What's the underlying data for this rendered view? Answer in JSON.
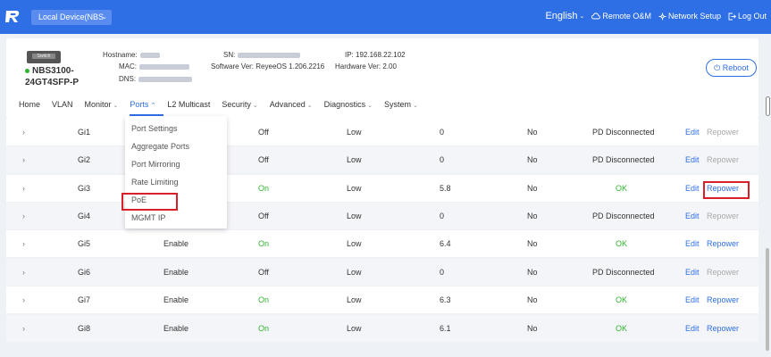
{
  "header": {
    "device_select": "Local Device(NBS",
    "language": "English",
    "remote": "Remote O&M",
    "network_setup": "Network Setup",
    "logout": "Log Out"
  },
  "device": {
    "model_line1": "NBS3100-",
    "model_line2": "24GT4SFP-P",
    "switch_label": "Switch",
    "hostname_label": "Hostname:",
    "mac_label": "MAC:",
    "dns_label": "DNS:",
    "sn_label": "SN:",
    "software_label": "Software Ver:",
    "software_value": "ReyeeOS 1.206.2216",
    "ip_label": "IP:",
    "ip_value": "192.168.22.102",
    "hardware_label": "Hardware Ver:",
    "hardware_value": "2.00",
    "reboot": "Reboot"
  },
  "menu": {
    "home": "Home",
    "vlan": "VLAN",
    "monitor": "Monitor",
    "ports": "Ports",
    "l2multicast": "L2 Multicast",
    "security": "Security",
    "advanced": "Advanced",
    "diagnostics": "Diagnostics",
    "system": "System"
  },
  "ports_dropdown": {
    "port_settings": "Port Settings",
    "aggregate_ports": "Aggregate Ports",
    "port_mirroring": "Port Mirroring",
    "rate_limiting": "Rate Limiting",
    "poe": "PoE",
    "mgmt_ip": "MGMT IP"
  },
  "rows": [
    {
      "port": "Gi1",
      "enable": "",
      "status": "Off",
      "priority": "Low",
      "power": "0",
      "nonstd": "No",
      "pd": "PD Disconnected",
      "edit": "Edit",
      "repower": "Repower"
    },
    {
      "port": "Gi2",
      "enable": "",
      "status": "Off",
      "priority": "Low",
      "power": "0",
      "nonstd": "No",
      "pd": "PD Disconnected",
      "edit": "Edit",
      "repower": "Repower"
    },
    {
      "port": "Gi3",
      "enable": "",
      "status": "On",
      "priority": "Low",
      "power": "5.8",
      "nonstd": "No",
      "pd": "OK",
      "edit": "Edit",
      "repower": "Repower"
    },
    {
      "port": "Gi4",
      "enable": "",
      "status": "Off",
      "priority": "Low",
      "power": "0",
      "nonstd": "No",
      "pd": "PD Disconnected",
      "edit": "Edit",
      "repower": "Repower"
    },
    {
      "port": "Gi5",
      "enable": "Enable",
      "status": "On",
      "priority": "Low",
      "power": "6.4",
      "nonstd": "No",
      "pd": "OK",
      "edit": "Edit",
      "repower": "Repower"
    },
    {
      "port": "Gi6",
      "enable": "Enable",
      "status": "Off",
      "priority": "Low",
      "power": "0",
      "nonstd": "No",
      "pd": "PD Disconnected",
      "edit": "Edit",
      "repower": "Repower"
    },
    {
      "port": "Gi7",
      "enable": "Enable",
      "status": "On",
      "priority": "Low",
      "power": "6.3",
      "nonstd": "No",
      "pd": "OK",
      "edit": "Edit",
      "repower": "Repower"
    },
    {
      "port": "Gi8",
      "enable": "Enable",
      "status": "On",
      "priority": "Low",
      "power": "6.1",
      "nonstd": "No",
      "pd": "OK",
      "edit": "Edit",
      "repower": "Repower"
    }
  ],
  "colors": {
    "brand_blue": "#2f6fe6",
    "ok_green": "#2eb32e",
    "highlight_red": "#d9202a"
  }
}
